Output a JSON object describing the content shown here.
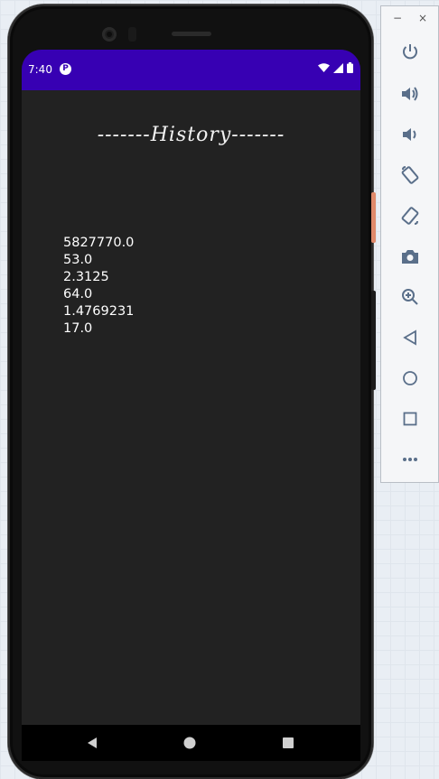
{
  "status_bar": {
    "time": "7:40",
    "app_badge": "P"
  },
  "app": {
    "title": "-------History-------",
    "history": [
      "5827770.0",
      "53.0",
      "2.3125",
      "64.0",
      "1.4769231",
      "17.0"
    ]
  },
  "emulator_toolbar": {
    "minimize": "−",
    "close": "×",
    "items": [
      "power-icon",
      "volume-up-icon",
      "volume-down-icon",
      "rotate-left-icon",
      "rotate-right-icon",
      "camera-icon",
      "zoom-icon",
      "back-icon",
      "home-icon",
      "overview-icon",
      "more-icon"
    ],
    "icon_color": "#5a6f8a"
  },
  "colors": {
    "status_bar": "#3700b3",
    "screen_bg": "#222222",
    "text": "#ffffff"
  }
}
